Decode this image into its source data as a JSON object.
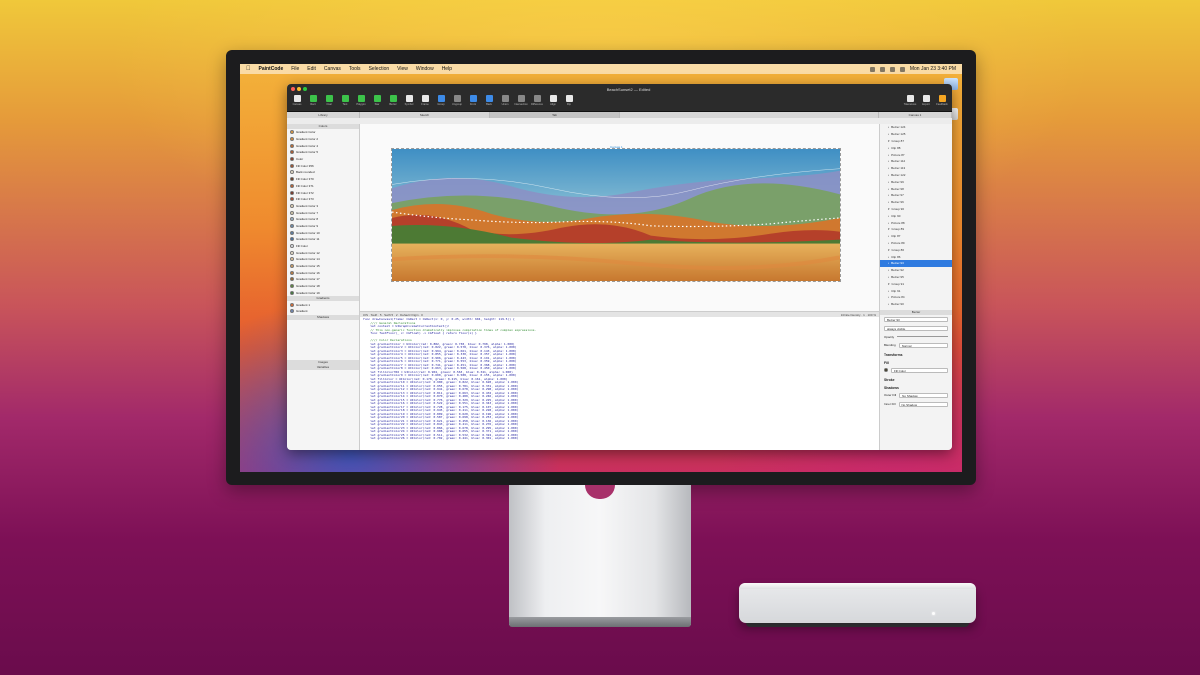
{
  "menubar": {
    "app_name": "PaintCode",
    "items": [
      "File",
      "Edit",
      "Canvas",
      "Tools",
      "Selection",
      "View",
      "Window",
      "Help"
    ],
    "clock": "Mon Jan 23  3:40 PM"
  },
  "window": {
    "title": "BeachSunset2 — Edited"
  },
  "toolbar": {
    "left": [
      {
        "label": "Canvas",
        "icon": "canvas-icon",
        "color": "#e8e8e8"
      },
      {
        "label": "Rect",
        "icon": "rect-icon",
        "color": "#3cc34a"
      },
      {
        "label": "Oval",
        "icon": "oval-icon",
        "color": "#3cc34a"
      },
      {
        "label": "Text",
        "icon": "text-icon",
        "color": "#3cc34a"
      },
      {
        "label": "Polygon",
        "icon": "polygon-icon",
        "color": "#3cc34a"
      },
      {
        "label": "Star",
        "icon": "star-icon",
        "color": "#3cc34a"
      },
      {
        "label": "Bezier",
        "icon": "bezier-icon",
        "color": "#3cc34a"
      },
      {
        "label": "Symbol",
        "icon": "symbol-icon",
        "color": "#e8e8e8"
      },
      {
        "label": "Frame",
        "icon": "frame-icon",
        "color": "#e8e8e8"
      },
      {
        "label": "Group",
        "icon": "group-icon",
        "color": "#3d8be8"
      },
      {
        "label": "Ungroup",
        "icon": "ungroup-icon",
        "color": "#888888"
      },
      {
        "label": "Front",
        "icon": "front-icon",
        "color": "#3d8be8"
      },
      {
        "label": "Back",
        "icon": "back-icon",
        "color": "#3d8be8"
      },
      {
        "label": "Union",
        "icon": "union-icon",
        "color": "#888888"
      },
      {
        "label": "Intersection",
        "icon": "intersection-icon",
        "color": "#888888"
      },
      {
        "label": "Difference",
        "icon": "difference-icon",
        "color": "#888888"
      },
      {
        "label": "Align",
        "icon": "align-icon",
        "color": "#e8e8e8"
      },
      {
        "label": "Flip",
        "icon": "flip-icon",
        "color": "#e8e8e8"
      }
    ],
    "right": [
      {
        "label": "Tolerances",
        "icon": "tolerance-icon",
        "color": "#e8e8e8"
      },
      {
        "label": "Export",
        "icon": "export-icon",
        "color": "#e8e8e8"
      },
      {
        "label": "Feedback",
        "icon": "feedback-icon",
        "color": "#f5a623"
      }
    ]
  },
  "tabs": {
    "library": "Library",
    "sketch": "Sketch",
    "tab": "Tab",
    "canvas": "Canvas 1"
  },
  "library": {
    "colors_header": "Colors",
    "colors": [
      {
        "name": "Gradient Color",
        "hex": "#e69b3a"
      },
      {
        "name": "Gradient Color 2",
        "hex": "#d98a34"
      },
      {
        "name": "Gradient Color 4",
        "hex": "#c46b2c"
      },
      {
        "name": "Gradient Color 5",
        "hex": "#b55a2a"
      },
      {
        "name": "Color",
        "hex": "#8f3a22"
      },
      {
        "name": "Fill Color 356",
        "hex": "#a3512a"
      },
      {
        "name": "Back rounded",
        "hex": "#f0e6d0"
      },
      {
        "name": "Fill Color 370",
        "hex": "#6a3a20"
      },
      {
        "name": "Fill Color 371",
        "hex": "#c06030"
      },
      {
        "name": "Fill Color 372",
        "hex": "#7a2e1e"
      },
      {
        "name": "Fill Color 373",
        "hex": "#b54a2a"
      },
      {
        "name": "Gradient Color 3",
        "hex": "#e8d8b8"
      },
      {
        "name": "Gradient Color 7",
        "hex": "#dcd0b0"
      },
      {
        "name": "Gradient Color 8",
        "hex": "#9fb4c8"
      },
      {
        "name": "Gradient Color 9",
        "hex": "#6f8fb0"
      },
      {
        "name": "Gradient Color 10",
        "hex": "#5a7fa8"
      },
      {
        "name": "Gradient Color 11",
        "hex": "#486fa0"
      },
      {
        "name": "Fill Color",
        "hex": "#e0e4ea"
      },
      {
        "name": "Gradient Color 12",
        "hex": "#f2e8d2"
      },
      {
        "name": "Gradient Color 14",
        "hex": "#e6c79a"
      },
      {
        "name": "Gradient Color 15",
        "hex": "#d2a064"
      },
      {
        "name": "Gradient Color 16",
        "hex": "#c47e3e"
      },
      {
        "name": "Gradient Color 17",
        "hex": "#9a6a30"
      },
      {
        "name": "Gradient Color 18",
        "hex": "#5a8a3a"
      },
      {
        "name": "Gradient Color 19",
        "hex": "#3f7a36"
      }
    ],
    "gradients_header": "Gradients",
    "gradients": [
      {
        "name": "Gradient 1",
        "hex": "#e26a2c"
      },
      {
        "name": "Gradient",
        "hex": "#6d86b8"
      }
    ],
    "shadows_header": "Shadows",
    "images_header": "Images",
    "variables_header": "Variables"
  },
  "canvas": {
    "artboard_label": "Canvas 1"
  },
  "code_status": {
    "left": [
      "iOS · Swift · 5 · Swift 5 · 2 · Default Origin · 0"
    ],
    "right": "Infinite Density · 1 · 100 %"
  },
  "code_lines": [
    {
      "t": "func drawCanvas1(frame: CGRect = CGRect(x: 0, y: 0.25, width: 604, height: 119.5)) {",
      "k": "code"
    },
    {
      "t": "    //// General Declarations",
      "k": "c"
    },
    {
      "t": "    let context = UIGraphicsGetCurrentContext()!",
      "k": "code"
    },
    {
      "t": "    // This non-generic function dramatically improves compilation times of complex expressions.",
      "k": "c"
    },
    {
      "t": "    func fastFloor(_ x: CGFloat) -> CGFloat { return floor(x) }",
      "k": "code"
    },
    {
      "t": "",
      "k": "code"
    },
    {
      "t": "    //// Color Declarations",
      "k": "c"
    },
    {
      "t": "    let gradientColor = UIColor(red: 0.882, green: 0.738, blue: 0.798, alpha: 1.000)",
      "k": "code"
    },
    {
      "t": "    let gradientColor2 = UIColor(red: 0.822, green: 0.578, blue: 0.376, alpha: 1.000)",
      "k": "code"
    },
    {
      "t": "    let gradientColor3 = UIColor(red: 0.994, green: 0.661, blue: 0.143, alpha: 1.000)",
      "k": "code"
    },
    {
      "t": "    let gradientColor4 = UIColor(red: 0.855, green: 0.330, blue: 0.357, alpha: 1.000)",
      "k": "code"
    },
    {
      "t": "    let gradientColor5 = UIColor(red: 0.906, green: 0.443, blue: 0.191, alpha: 1.000)",
      "k": "code"
    },
    {
      "t": "    let gradientColor6 = UIColor(red: 0.771, green: 0.553, blue: 0.359, alpha: 1.000)",
      "k": "code"
    },
    {
      "t": "    let gradientColor7 = UIColor(red: 0.741, green: 0.451, blue: 0.368, alpha: 1.000)",
      "k": "code"
    },
    {
      "t": "    let gradientColor8 = UIColor(red: 0.663, green: 0.568, blue: 0.450, alpha: 1.000)",
      "k": "code"
    },
    {
      "t": "    let fillColor356 = UIColor(red: 0.904, green: 0.563, blue: 0.341, alpha: 1.000)",
      "k": "code"
    },
    {
      "t": "    let gradientColor9 = UIColor(red: 0.600, green: 0.588, blue: 0.155, alpha: 1.000)",
      "k": "code"
    },
    {
      "t": "    let fillColor = UIColor(red: 0.170, green: 0.215, blue: 0.161, alpha: 1.000)",
      "k": "code"
    },
    {
      "t": "    let gradientColor10 = UIColor(red: 0.900, green: 0.822, blue: 0.620, alpha: 1.000)",
      "k": "code"
    },
    {
      "t": "    let gradientColor11 = UIColor(red: 0.955, green: 0.781, blue: 0.331, alpha: 1.000)",
      "k": "code"
    },
    {
      "t": "    let gradientColor12 = UIColor(red: 0.941, green: 0.678, blue: 0.298, alpha: 1.000)",
      "k": "code"
    },
    {
      "t": "    let gradientColor13 = UIColor(red: 0.811, green: 0.663, blue: 0.432, alpha: 1.000)",
      "k": "code"
    },
    {
      "t": "    let gradientColor14 = UIColor(red: 0.870, green: 0.480, blue: 0.246, alpha: 1.000)",
      "k": "code"
    },
    {
      "t": "    let gradientColor15 = UIColor(red: 0.776, green: 0.329, blue: 0.225, alpha: 1.000)",
      "k": "code"
    },
    {
      "t": "    let gradientColor16 = UIColor(red: 0.522, green: 0.551, blue: 0.343, alpha: 1.000)",
      "k": "code"
    },
    {
      "t": "    let gradientColor17 = UIColor(red: 0.728, green: 0.175, blue: 0.107, alpha: 1.000)",
      "k": "code"
    },
    {
      "t": "    let gradientColor18 = UIColor(red: 0.945, green: 0.411, blue: 0.228, alpha: 1.000)",
      "k": "code"
    },
    {
      "t": "    let gradientColor19 = UIColor(red: 0.809, green: 0.620, blue: 0.196, alpha: 1.000)",
      "k": "code"
    },
    {
      "t": "    let gradientColor20 = UIColor(red: 0.587, green: 0.698, blue: 0.253, alpha: 1.000)",
      "k": "code"
    },
    {
      "t": "    let gradientColor21 = UIColor(red: 0.621, green: 0.458, blue: 0.136, alpha: 1.000)",
      "k": "code"
    },
    {
      "t": "    let gradientColor22 = UIColor(red: 0.843, green: 0.411, blue: 0.276, alpha: 1.000)",
      "k": "code"
    },
    {
      "t": "    let gradientColor23 = UIColor(red: 0.866, green: 0.678, blue: 0.295, alpha: 1.000)",
      "k": "code"
    },
    {
      "t": "    let gradientColor24 = UIColor(red: 0.908, green: 0.655, blue: 0.371, alpha: 1.000)",
      "k": "code"
    },
    {
      "t": "    let gradientColor25 = UIColor(red: 0.511, green: 0.532, blue: 0.324, alpha: 1.000)",
      "k": "code"
    },
    {
      "t": "    let gradientColor26 = UIColor(red: 0.702, green: 0.441, blue: 0.301, alpha: 1.000)",
      "k": "code"
    }
  ],
  "layers": [
    {
      "name": "Bezier 124",
      "selected": false
    },
    {
      "name": "Bezier 125",
      "selected": false
    },
    {
      "name": "Group 87",
      "selected": false
    },
    {
      "name": "Clip 88",
      "selected": false
    },
    {
      "name": "Picture 87",
      "selected": false
    },
    {
      "name": "Bezier 112",
      "selected": false
    },
    {
      "name": "Bezier 113",
      "selected": false
    },
    {
      "name": "Bezier 122",
      "selected": false
    },
    {
      "name": "Bezier 99",
      "selected": false
    },
    {
      "name": "Bezier 98",
      "selected": false
    },
    {
      "name": "Bezier 97",
      "selected": false
    },
    {
      "name": "Bezier 96",
      "selected": false
    },
    {
      "name": "Group 90",
      "selected": false
    },
    {
      "name": "Clip 90",
      "selected": false
    },
    {
      "name": "Picture 88",
      "selected": false
    },
    {
      "name": "Group 89",
      "selected": false
    },
    {
      "name": "Clip 87",
      "selected": false
    },
    {
      "name": "Picture 89",
      "selected": false
    },
    {
      "name": "Group 86",
      "selected": false
    },
    {
      "name": "Clip 86",
      "selected": false
    },
    {
      "name": "Bezier 93",
      "selected": true
    },
    {
      "name": "Bezier 92",
      "selected": false
    },
    {
      "name": "Bezier 95",
      "selected": false
    },
    {
      "name": "Group 91",
      "selected": false
    },
    {
      "name": "Clip 91",
      "selected": false
    },
    {
      "name": "Picture 84",
      "selected": false
    },
    {
      "name": "Bezier 90",
      "selected": false
    }
  ],
  "inspector": {
    "header": "Bezier",
    "name_value": "Bezier 93",
    "always_visible": "always visible",
    "opacity_label": "Opacity",
    "blending_label": "Blending",
    "blending_value": "Normal",
    "transforms": "Transforms",
    "fill": "Fill",
    "fill_color": "Fill Color",
    "stroke": "Stroke",
    "shadows": "Shadows",
    "outer_label": "Outer Fill",
    "outer_value": "No Shadow",
    "inner_label": "Inner Fill",
    "inner_value": "No Shadow"
  },
  "colors": {
    "window_chrome": "#2b2b2b",
    "selection": "#2f7be0",
    "tool_green": "#3cc34a"
  }
}
